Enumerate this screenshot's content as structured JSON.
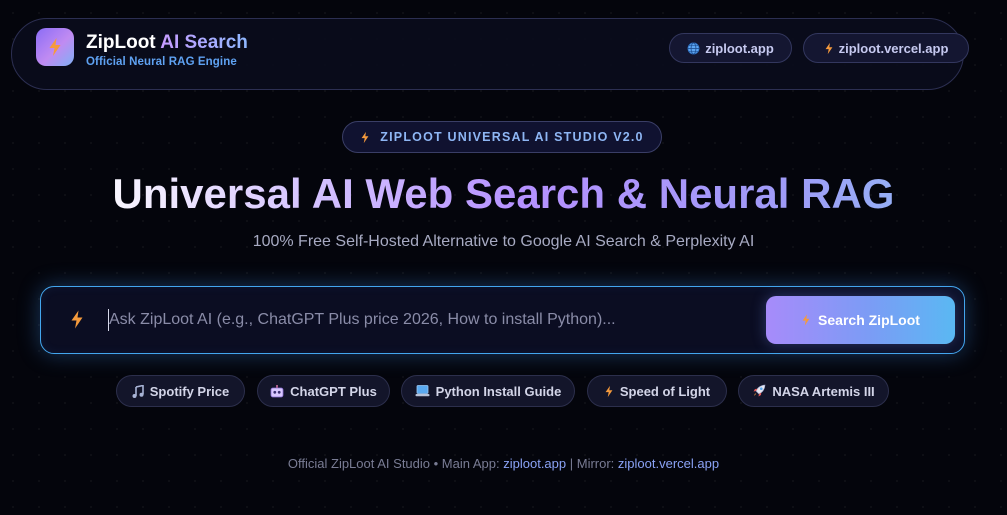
{
  "header": {
    "brand_word1": "ZipLoot",
    "brand_word2": "AI Search",
    "subtitle": "Official Neural RAG Engine",
    "links": [
      {
        "label": "ziploot.app",
        "icon": "globe-icon"
      },
      {
        "label": "ziploot.vercel.app",
        "icon": "lightning-icon"
      }
    ]
  },
  "badge": {
    "label": "ZIPLOOT UNIVERSAL AI STUDIO V2.0",
    "icon": "lightning-icon"
  },
  "hero": {
    "title": "Universal AI Web Search & Neural RAG",
    "subtitle": "100% Free Self-Hosted Alternative to Google AI Search & Perplexity AI"
  },
  "search": {
    "placeholder": "Ask ZipLoot AI (e.g., ChatGPT Plus price 2026, How to install Python)...",
    "value": "",
    "button_label": "Search ZipLoot"
  },
  "chips": [
    {
      "label": "Spotify Price",
      "icon": "music-note-icon"
    },
    {
      "label": "ChatGPT Plus",
      "icon": "robot-icon"
    },
    {
      "label": "Python Install Guide",
      "icon": "laptop-icon"
    },
    {
      "label": "Speed of Light",
      "icon": "lightning-icon"
    },
    {
      "label": "NASA Artemis III",
      "icon": "rocket-icon"
    }
  ],
  "footer": {
    "prefix": "Official ZipLoot AI Studio • Main App:",
    "main_link": "ziploot.app",
    "separator": "| Mirror:",
    "mirror_link": "ziploot.vercel.app"
  },
  "colors": {
    "background": "#04050c",
    "accent_purple": "#a78bfa",
    "accent_blue": "#43a6ee",
    "lightning": "#f59a3c"
  }
}
